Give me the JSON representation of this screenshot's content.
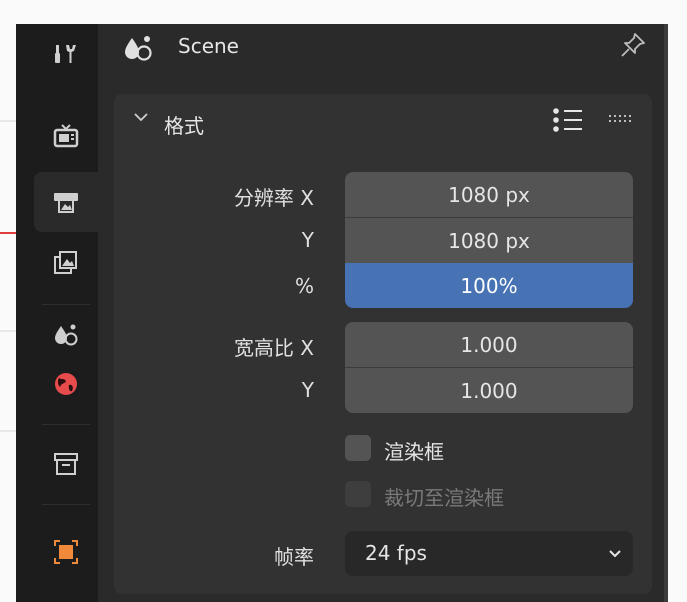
{
  "colors": {
    "accent_blue": "#4772b3",
    "panel_bg": "#2a2a2a",
    "section_bg": "#323232",
    "field_bg": "#545454"
  },
  "tabs": [
    {
      "icon": "tool-icon",
      "active": false
    },
    {
      "icon": "render-icon",
      "active": false
    },
    {
      "icon": "output-icon",
      "active": true
    },
    {
      "icon": "view-layer-icon",
      "active": false
    },
    {
      "icon": "scene-icon",
      "active": false
    },
    {
      "icon": "world-icon",
      "active": false
    },
    {
      "icon": "collection-icon",
      "active": false
    },
    {
      "icon": "object-icon",
      "active": false
    }
  ],
  "header": {
    "title": "Scene",
    "icon": "scene-icon",
    "pin_icon": "pin-icon"
  },
  "section": {
    "title": "格式",
    "expanded": true
  },
  "resolution": {
    "label_x": "分辨率 X",
    "label_y": "Y",
    "label_pct": "%",
    "x_value": "1080 px",
    "y_value": "1080 px",
    "pct_value": "100%"
  },
  "aspect": {
    "label_x": "宽高比 X",
    "label_y": "Y",
    "x_value": "1.000",
    "y_value": "1.000"
  },
  "checkboxes": {
    "render_region_label": "渲染框",
    "render_region_checked": false,
    "crop_label": "裁切至渲染框",
    "crop_checked": false
  },
  "framerate": {
    "label": "帧率",
    "value": "24 fps"
  }
}
